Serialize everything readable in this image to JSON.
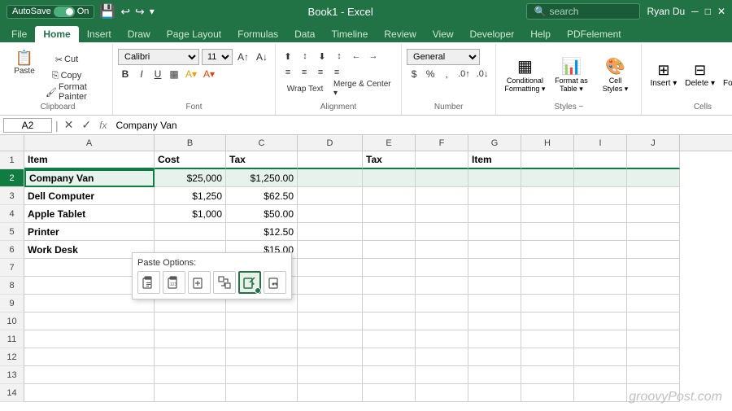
{
  "title_bar": {
    "autosave_label": "AutoSave",
    "autosave_state": "On",
    "file_name": "Book1 - Excel",
    "user_name": "Ryan Du",
    "search_placeholder": "search"
  },
  "ribbon_tabs": {
    "tabs": [
      "File",
      "Home",
      "Insert",
      "Draw",
      "Page Layout",
      "Formulas",
      "Data",
      "Timeline",
      "Review",
      "View",
      "Developer",
      "Help",
      "PDFelement"
    ],
    "active_tab": "Home"
  },
  "ribbon": {
    "groups": {
      "clipboard": {
        "label": "Clipboard",
        "paste_label": "Paste",
        "cut_label": "Cut",
        "copy_label": "Copy",
        "format_painter_label": "Format Painter"
      },
      "font": {
        "label": "Font",
        "font_name": "Calibri",
        "font_size": "11",
        "bold": "B",
        "italic": "I",
        "underline": "U"
      },
      "alignment": {
        "label": "Alignment",
        "wrap_text": "Wrap Text",
        "merge_center": "Merge & Center"
      },
      "number": {
        "label": "Number",
        "format": "General",
        "dollar": "$",
        "percent": "%",
        "comma": ","
      },
      "styles": {
        "label": "Styles ~",
        "conditional_formatting": "Conditional\nFormatting",
        "format_table": "Format as\nTable",
        "cell_styles": "Cell\nStyles"
      },
      "cells": {
        "label": "Cells",
        "insert": "Insert",
        "delete": "Delete",
        "format": "Format"
      }
    }
  },
  "formula_bar": {
    "cell_ref": "A2",
    "formula_content": "Company Van"
  },
  "spreadsheet": {
    "columns": [
      "A",
      "B",
      "C",
      "D",
      "E",
      "F",
      "G",
      "H",
      "I",
      "J"
    ],
    "rows": [
      {
        "num": "1",
        "cells": [
          "Item",
          "Cost",
          "Tax",
          "",
          "Tax",
          "",
          "Item",
          "",
          "",
          ""
        ]
      },
      {
        "num": "2",
        "cells": [
          "Company Van",
          "$25,000",
          "$1,250.00",
          "",
          "",
          "",
          "",
          "",
          "",
          ""
        ]
      },
      {
        "num": "3",
        "cells": [
          "Dell Computer",
          "$1,250",
          "$62.50",
          "",
          "",
          "",
          "",
          "",
          "",
          ""
        ]
      },
      {
        "num": "4",
        "cells": [
          "Apple Tablet",
          "$1,000",
          "$50.00",
          "",
          "",
          "",
          "",
          "",
          "",
          ""
        ]
      },
      {
        "num": "5",
        "cells": [
          "Printer",
          "",
          "$12.50",
          "",
          "",
          "",
          "",
          "",
          "",
          ""
        ]
      },
      {
        "num": "6",
        "cells": [
          "Work Desk",
          "",
          "$15.00",
          "",
          "",
          "",
          "",
          "",
          "",
          ""
        ]
      },
      {
        "num": "7",
        "cells": [
          "",
          "",
          "",
          "",
          "",
          "",
          "",
          "",
          "",
          ""
        ]
      },
      {
        "num": "8",
        "cells": [
          "",
          "",
          "",
          "",
          "",
          "",
          "",
          "",
          "",
          ""
        ]
      },
      {
        "num": "9",
        "cells": [
          "",
          "",
          "",
          "",
          "",
          "",
          "",
          "",
          "",
          ""
        ]
      },
      {
        "num": "10",
        "cells": [
          "",
          "",
          "",
          "",
          "",
          "",
          "",
          "",
          "",
          ""
        ]
      },
      {
        "num": "11",
        "cells": [
          "",
          "",
          "",
          "",
          "",
          "",
          "",
          "",
          "",
          ""
        ]
      },
      {
        "num": "12",
        "cells": [
          "",
          "",
          "",
          "",
          "",
          "",
          "",
          "",
          "",
          ""
        ]
      },
      {
        "num": "13",
        "cells": [
          "",
          "",
          "",
          "",
          "",
          "",
          "",
          "",
          "",
          ""
        ]
      },
      {
        "num": "14",
        "cells": [
          "",
          "",
          "",
          "",
          "",
          "",
          "",
          "",
          "",
          ""
        ]
      }
    ]
  },
  "paste_options": {
    "label": "Paste Options:",
    "icons": [
      "📋",
      "📋₁₂₃",
      "📋📐",
      "📋→",
      "📋🎨",
      "📋🔗"
    ]
  },
  "watermark": {
    "text": "groovyPost.com"
  }
}
